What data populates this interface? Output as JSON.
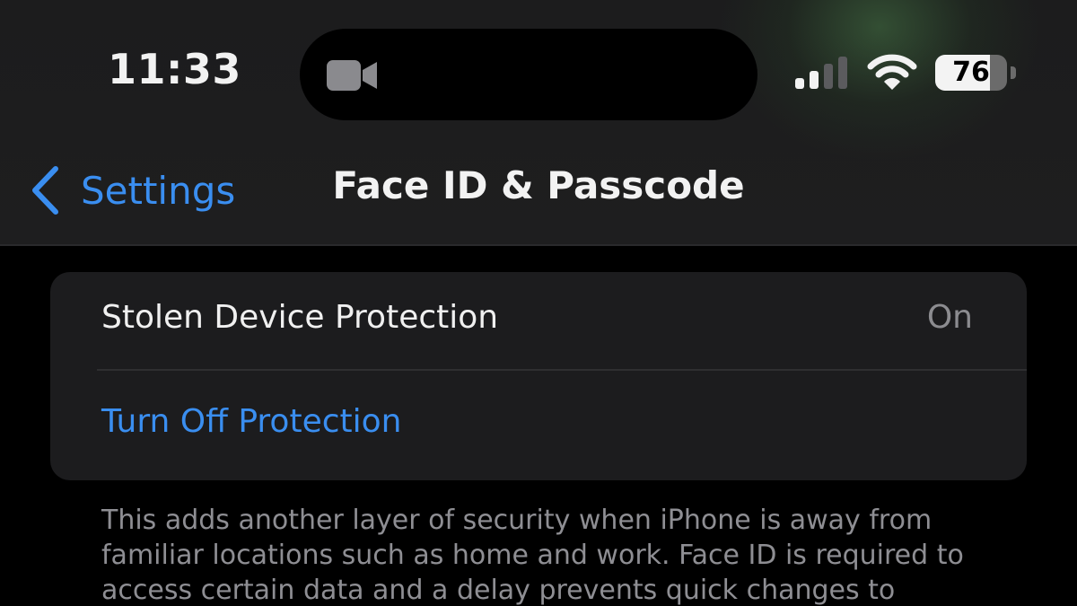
{
  "status_bar": {
    "time": "11:33",
    "battery_level": "76",
    "battery_fraction": 0.76,
    "signal_bars_active": 2,
    "icons": [
      "video-camera-icon",
      "cellular-signal-icon",
      "wifi-icon",
      "battery-icon"
    ]
  },
  "nav": {
    "back_label": "Settings",
    "title": "Face ID & Passcode"
  },
  "group": {
    "rows": [
      {
        "label": "Stolen Device Protection",
        "value": "On"
      },
      {
        "label": "Turn Off Protection"
      }
    ]
  },
  "footer": {
    "text": "This adds another layer of security when iPhone is away from familiar locations such as home and work. Face ID is required to access certain data and a delay prevents quick changes to"
  },
  "colors": {
    "accent": "#3a8ef0",
    "background": "#000000",
    "card": "#1c1c1e",
    "secondary_text": "#8e8e93"
  }
}
